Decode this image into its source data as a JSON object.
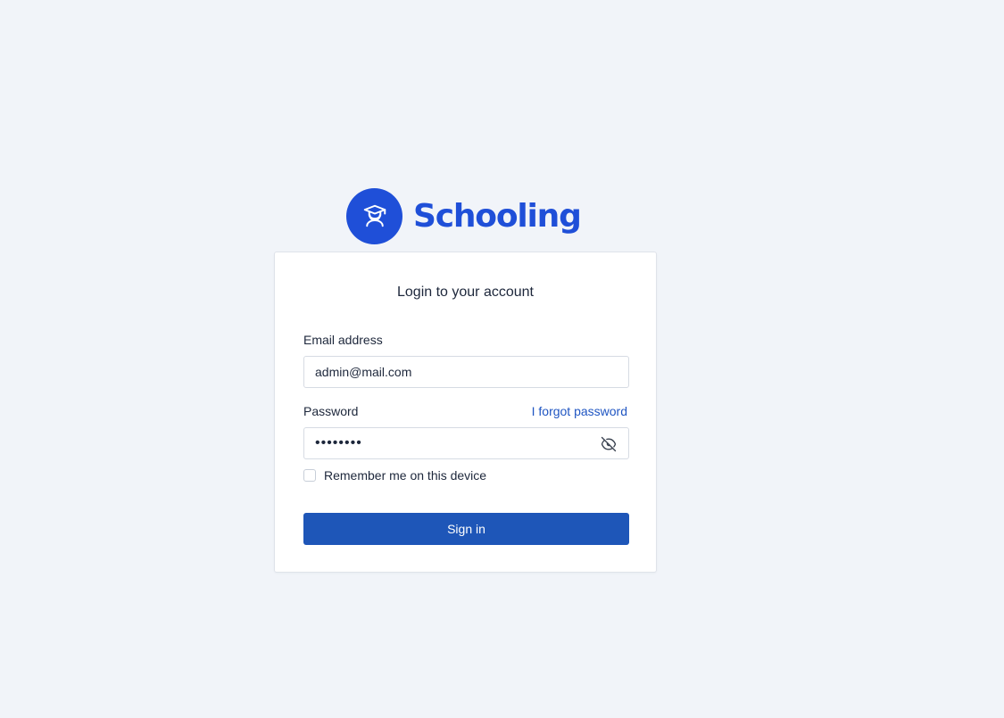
{
  "brand": {
    "name": "Schooling",
    "logo_icon": "graduation-cap-student-icon",
    "color": "#1f4fd8"
  },
  "login": {
    "title": "Login to your account",
    "email_label": "Email address",
    "email_value": "admin@mail.com",
    "password_label": "Password",
    "forgot_label": "I forgot password",
    "password_value": "••••••••",
    "password_toggle_icon": "eye-off-icon",
    "remember_label": "Remember me on this device",
    "remember_checked": false,
    "signin_label": "Sign in",
    "button_color": "#1e56b8",
    "link_color": "#1f55c2"
  }
}
